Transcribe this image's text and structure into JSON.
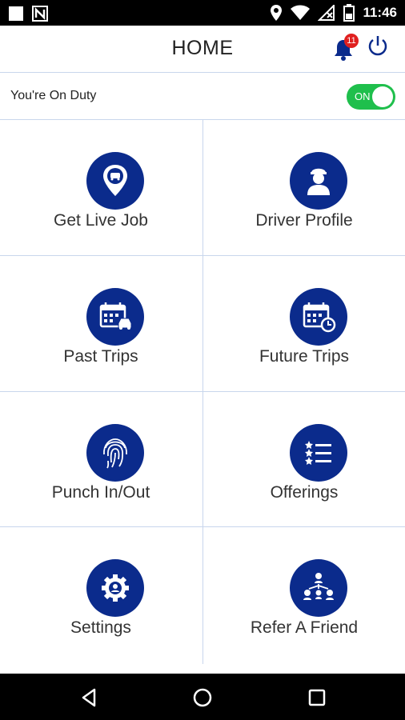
{
  "status_bar": {
    "time": "11:46",
    "icons": [
      "square-icon",
      "n-notification-icon",
      "location-icon",
      "wifi-icon",
      "no-signal-icon",
      "battery-icon"
    ]
  },
  "app_bar": {
    "title": "HOME",
    "notification_count": "11",
    "icons": [
      "bell-icon",
      "power-icon"
    ]
  },
  "duty": {
    "label": "You're On Duty",
    "toggle_text": "ON",
    "toggle_color": "#1fbf4c"
  },
  "tiles": [
    {
      "label": "Get Live Job",
      "icon": "car-location-pin-icon"
    },
    {
      "label": "Driver Profile",
      "icon": "driver-icon"
    },
    {
      "label": "Past Trips",
      "icon": "calendar-car-icon"
    },
    {
      "label": "Future Trips",
      "icon": "calendar-clock-icon"
    },
    {
      "label": "Punch In/Out",
      "icon": "fingerprint-icon"
    },
    {
      "label": "Offerings",
      "icon": "star-list-icon"
    },
    {
      "label": "Settings",
      "icon": "gear-user-icon"
    },
    {
      "label": "Refer A Friend",
      "icon": "referral-network-icon"
    }
  ],
  "colors": {
    "icon_circle": "#0b2b8c",
    "divider": "#c8d6ec",
    "badge": "#e0201f"
  },
  "nav_bar": {
    "icons": [
      "back-icon",
      "home-icon",
      "recents-icon"
    ]
  }
}
